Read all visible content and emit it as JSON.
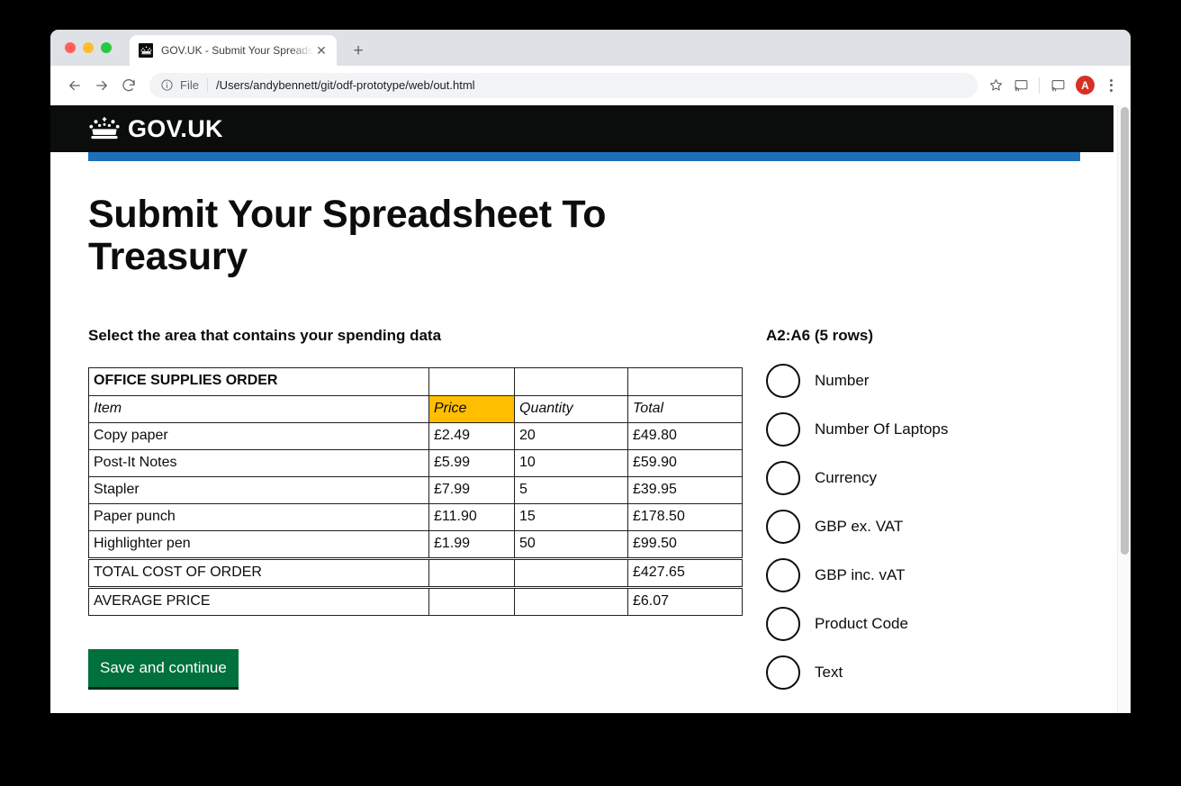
{
  "browser": {
    "tab": {
      "title": "GOV.UK - Submit Your Spreadsheet To Treasury",
      "favicon_icon": "govuk-crown-icon",
      "close_icon": "close-icon"
    },
    "new_tab_label": "+",
    "toolbar": {
      "back_icon": "arrow-left-icon",
      "forward_icon": "arrow-right-icon",
      "reload_icon": "reload-icon",
      "info_icon": "info-circle-icon",
      "scheme_label": "File",
      "url": "/Users/andybennett/git/odf-prototype/web/out.html",
      "bookmark_icon": "star-icon",
      "cast_icon": "cast-icon",
      "cast_icon_secondary": "cast-icon",
      "avatar_initial": "A",
      "menu_icon": "kebab-menu-icon"
    }
  },
  "site_header": {
    "logo_icon": "govuk-crown-icon",
    "wordmark": "GOV.UK",
    "accent_color": "#1d70b8",
    "header_background": "#0b0c0c"
  },
  "main": {
    "page_title": "Submit Your Spreadsheet To Treasury",
    "legend": "Select the area that contains your spending data",
    "save_button": "Save and continue",
    "save_button_color": "#00703c"
  },
  "spreadsheet": {
    "highlight_color": "#ffbf00",
    "title_row": [
      "OFFICE SUPPLIES ORDER",
      "",
      "",
      ""
    ],
    "header_row": [
      "Item",
      "Price",
      "Quantity",
      "Total"
    ],
    "highlighted_cell": "Price",
    "rows": [
      [
        "Copy paper",
        "£2.49",
        "20",
        "£49.80"
      ],
      [
        "Post-It Notes",
        "£5.99",
        "10",
        "£59.90"
      ],
      [
        "Stapler",
        "£7.99",
        "5",
        "£39.95"
      ],
      [
        "Paper punch",
        "£11.90",
        "15",
        "£178.50"
      ],
      [
        "Highlighter pen",
        "£1.99",
        "50",
        "£99.50"
      ]
    ],
    "summary_rows": [
      [
        "TOTAL COST OF ORDER",
        "",
        "",
        "£427.65"
      ],
      [
        "AVERAGE PRICE",
        "",
        "",
        "£6.07"
      ]
    ]
  },
  "selection_panel": {
    "range_label": "A2:A6 (5 rows)",
    "options": [
      {
        "label": "Number",
        "selected": false
      },
      {
        "label": "Number Of Laptops",
        "selected": false
      },
      {
        "label": "Currency",
        "selected": false
      },
      {
        "label": "GBP ex. VAT",
        "selected": false
      },
      {
        "label": "GBP inc. vAT",
        "selected": false
      },
      {
        "label": "Product Code",
        "selected": false
      },
      {
        "label": "Text",
        "selected": false
      }
    ]
  }
}
